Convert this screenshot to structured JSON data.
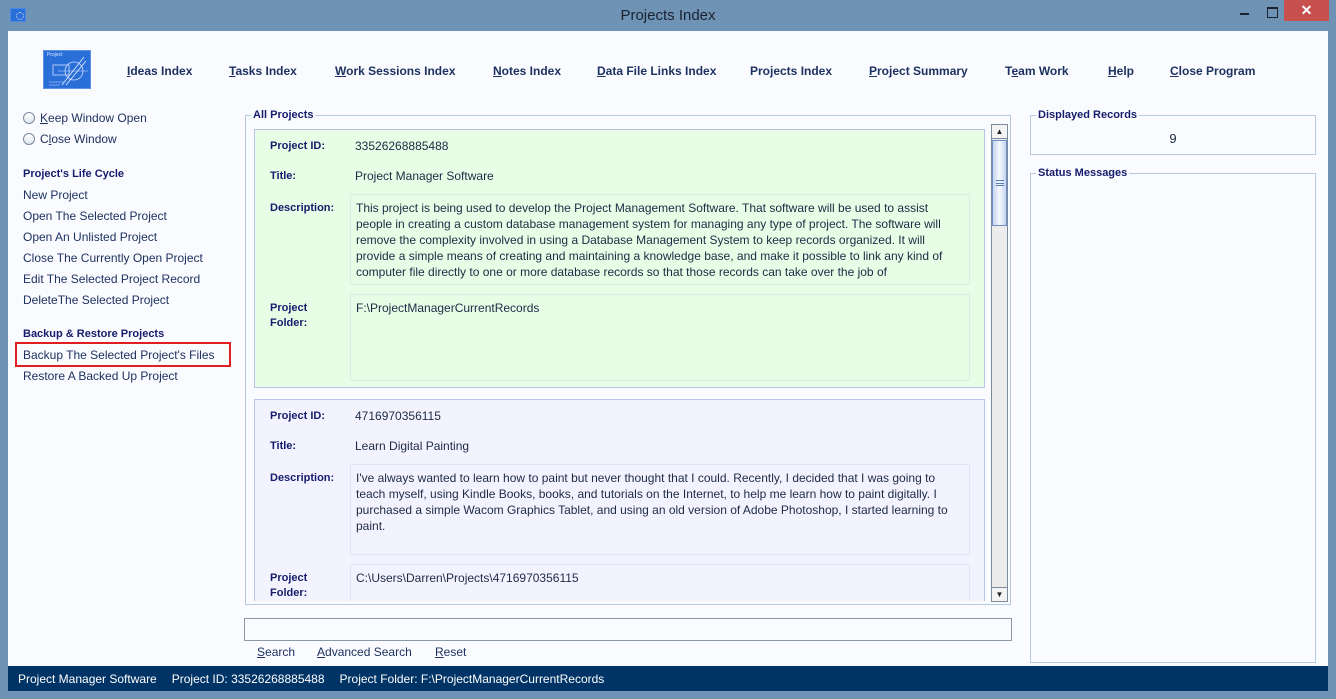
{
  "window": {
    "title": "Projects Index",
    "controls": {
      "close_glyph": "✕"
    }
  },
  "logo": {
    "text": "Project",
    "icon": "project-logo-icon"
  },
  "nav": [
    {
      "pre": "",
      "ul": "I",
      "post": "deas Index"
    },
    {
      "pre": "",
      "ul": "T",
      "post": "asks Index"
    },
    {
      "pre": "",
      "ul": "W",
      "post": "ork Sessions Index"
    },
    {
      "pre": "",
      "ul": "N",
      "post": "otes Index"
    },
    {
      "pre": "",
      "ul": "D",
      "post": "ata File Links Index"
    },
    {
      "pre": "Projects Index",
      "ul": "",
      "post": ""
    },
    {
      "pre": "",
      "ul": "P",
      "post": "roject Summary"
    },
    {
      "pre": "T",
      "ul": "e",
      "post": "am Work"
    },
    {
      "pre": "",
      "ul": "H",
      "post": "elp"
    },
    {
      "pre": "",
      "ul": "C",
      "post": "lose Program"
    }
  ],
  "sidebar": {
    "radios": [
      {
        "pre": "",
        "ul": "K",
        "post": "eep Window Open",
        "selected": false
      },
      {
        "pre": "C",
        "ul": "l",
        "post": "ose Window",
        "selected": false
      }
    ],
    "life_cycle_heading": "Project's Life Cycle",
    "life_cycle_links": [
      "New Project",
      "Open The Selected Project",
      "Open An Unlisted Project",
      "Close The Currently Open Project",
      "Edit The Selected Project Record",
      "DeleteThe Selected Project"
    ],
    "backup_heading": "Backup & Restore Projects",
    "backup_links": [
      "Backup The Selected Project's Files",
      "Restore A Backed Up Project"
    ],
    "highlighted_link": "Backup The Selected Project's Files"
  },
  "projects_panel": {
    "label": "All Projects",
    "field_labels": {
      "id": "Project ID:",
      "title": "Title:",
      "description": "Description:",
      "folder_line1": "Project",
      "folder_line2": "Folder:"
    },
    "records": [
      {
        "id": "33526268885488",
        "title": "Project Manager Software",
        "description": "This project is being used to develop the Project Management Software. That software will be used to assist people in creating a custom database management system for managing any type of project. The software will remove the complexity involved in using a Database Management System to keep records organized. It will provide a simple means of creating and maintaining a knowledge base, and make it possible to link any kind of computer file directly to one or more database records so that those records can take over the job of",
        "folder": "F:\\ProjectManagerCurrentRecords"
      },
      {
        "id": "4716970356115",
        "title": "Learn Digital Painting",
        "description": "I've always wanted to learn how to paint but never thought that I could. Recently, I decided that I was going to teach myself, using Kindle Books, books, and tutorials on the Internet, to help me learn how to paint digitally. I purchased a simple Wacom Graphics Tablet, and using an old version of Adobe Photoshop, I started learning to paint.",
        "folder": "C:\\Users\\Darren\\Projects\\4716970356115"
      }
    ],
    "scroll_position_fraction": 0.0
  },
  "search": {
    "input_value": "",
    "buttons": [
      {
        "ul": "S",
        "post": "earch"
      },
      {
        "ul": "A",
        "post": "dvanced Search"
      },
      {
        "ul": "R",
        "post": "eset"
      }
    ]
  },
  "displayed_records": {
    "label": "Displayed Records",
    "value": "9"
  },
  "status_messages": {
    "label": "Status Messages",
    "text": ""
  },
  "statusbar": {
    "app": "Project Manager Software",
    "project_id": "Project ID:  33526268885488",
    "project_folder": "Project Folder: F:\\ProjectManagerCurrentRecords"
  }
}
